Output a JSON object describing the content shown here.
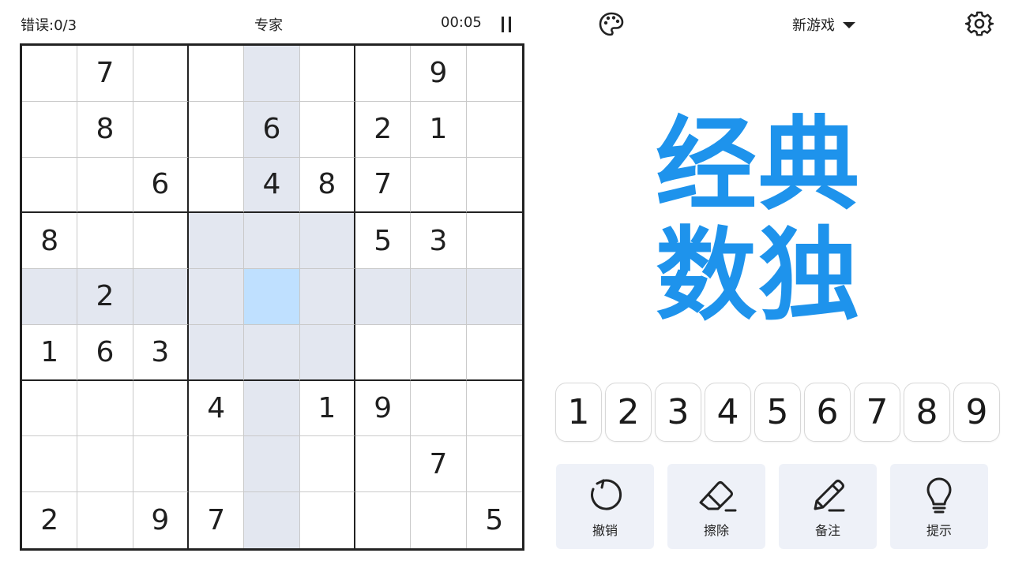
{
  "topbar": {
    "mistakes": "错误:0/3",
    "difficulty": "专家",
    "timer": "00:05",
    "new_game": "新游戏"
  },
  "icons": {
    "palette": "palette-icon",
    "settings": "gear-icon",
    "pause": "pause-icon",
    "dropdown": "chevron-down-icon"
  },
  "title": {
    "line1": "经典",
    "line2": "数独"
  },
  "colors": {
    "title": "#1e93ec",
    "highlight": "#e3e7f0",
    "selected": "#bfe0ff"
  },
  "board": {
    "selected": {
      "row": 5,
      "col": 5
    },
    "rows": [
      [
        "",
        "7",
        "",
        "",
        "",
        "",
        "",
        "9",
        ""
      ],
      [
        "",
        "8",
        "",
        "",
        "6",
        "",
        "2",
        "1",
        ""
      ],
      [
        "",
        "",
        "6",
        "",
        "4",
        "8",
        "7",
        "",
        ""
      ],
      [
        "8",
        "",
        "",
        "",
        "",
        "",
        "5",
        "3",
        ""
      ],
      [
        "",
        "2",
        "",
        "",
        "",
        "",
        "",
        "",
        ""
      ],
      [
        "1",
        "6",
        "3",
        "",
        "",
        "",
        "",
        "",
        ""
      ],
      [
        "",
        "",
        "",
        "4",
        "",
        "1",
        "9",
        "",
        ""
      ],
      [
        "",
        "",
        "",
        "",
        "",
        "",
        "",
        "7",
        ""
      ],
      [
        "2",
        "",
        "9",
        "7",
        "",
        "",
        "",
        "",
        "5"
      ]
    ]
  },
  "numpad": [
    "1",
    "2",
    "3",
    "4",
    "5",
    "6",
    "7",
    "8",
    "9"
  ],
  "tools": [
    {
      "label": "撤销",
      "icon": "undo-icon"
    },
    {
      "label": "擦除",
      "icon": "eraser-icon"
    },
    {
      "label": "备注",
      "icon": "pencil-icon"
    },
    {
      "label": "提示",
      "icon": "lightbulb-icon"
    }
  ]
}
